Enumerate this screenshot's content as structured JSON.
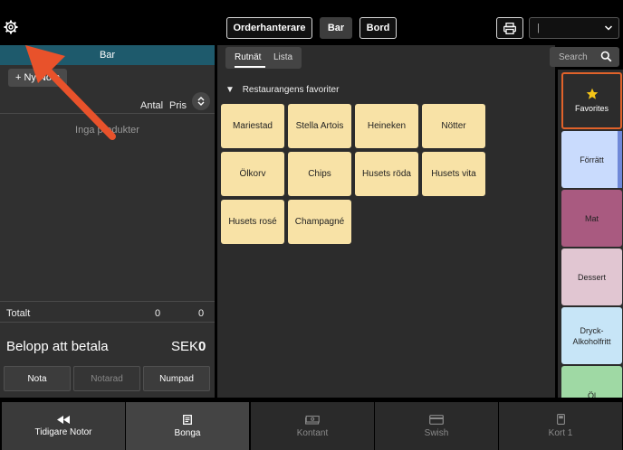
{
  "topbar": {
    "order_handler": "Orderhanterare",
    "bar": "Bar",
    "table": "Bord",
    "selector_value": "|"
  },
  "left": {
    "header": "Bar",
    "new_note": "+ Ny Nota",
    "col_qty": "Antal",
    "col_price": "Pris",
    "empty": "Inga produkter",
    "total_label": "Totalt",
    "total_qty": "0",
    "total_price": "0",
    "pay_label": "Belopp att betala",
    "currency": "SEK",
    "pay_amount": "0",
    "btn_note": "Nota",
    "btn_noted": "Notarad",
    "btn_numpad": "Numpad"
  },
  "main": {
    "tab_grid": "Rutnät",
    "tab_list": "Lista",
    "favorites_heading": "Restaurangens favoriter",
    "products": [
      "Mariestad",
      "Stella Artois",
      "Heineken",
      "Nötter",
      "Ölkorv",
      "Chips",
      "Husets röda",
      "Husets vita",
      "Husets rosé",
      "Champagné"
    ]
  },
  "search": {
    "placeholder": "Search"
  },
  "categories": [
    {
      "label": "Favorites",
      "color": "#2c2c2c"
    },
    {
      "label": "Förrätt",
      "color": "#c9dbfd"
    },
    {
      "label": "Mat",
      "color": "#a95a80"
    },
    {
      "label": "Dessert",
      "color": "#e1c6d2"
    },
    {
      "label": "Dryck-Alkoholfritt",
      "color": "#c7e5f7"
    },
    {
      "label": "Öl",
      "color": "#9fd9a4"
    }
  ],
  "footer": {
    "previous_notes": "Tidigare Notor",
    "bonga": "Bonga",
    "cash": "Kontant",
    "swish": "Swish",
    "card": "Kort 1"
  },
  "colors": {
    "accent": "#1e5a6c",
    "tile": "#f8e2a6",
    "annotation_arrow": "#e8522b"
  }
}
